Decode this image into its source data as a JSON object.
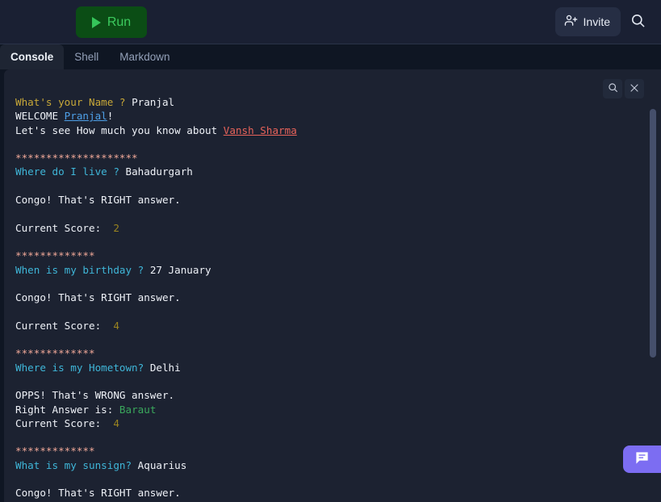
{
  "toolbar": {
    "run_label": "Run",
    "invite_label": "Invite",
    "run_icon": "play-triangle-icon",
    "invite_icon": "person-add-icon",
    "search_icon": "search-icon",
    "accent_green": "#3ccb5e",
    "run_bg": "#0b4d15"
  },
  "tabs": [
    {
      "label": "Console",
      "active": true
    },
    {
      "label": "Shell",
      "active": false
    },
    {
      "label": "Markdown",
      "active": false
    }
  ],
  "console": {
    "tools": [
      {
        "icon": "search-icon",
        "name": "console-search-button"
      },
      {
        "icon": "close-icon",
        "name": "console-close-button"
      }
    ],
    "lines": [
      {
        "id": "l1",
        "text": "What's your Name ? Pranjal"
      },
      {
        "id": "l2",
        "text": "WELCOME Pranjal!"
      },
      {
        "id": "l3",
        "text": "Let's see How much you know about Vansh Sharma"
      },
      {
        "id": "l4",
        "text": ""
      },
      {
        "id": "l5",
        "text": "********************"
      },
      {
        "id": "l6",
        "text": "Where do I live ? Bahadurgarh"
      },
      {
        "id": "l7",
        "text": ""
      },
      {
        "id": "l8",
        "text": "Congo! That's RIGHT answer."
      },
      {
        "id": "l9",
        "text": ""
      },
      {
        "id": "l10",
        "text": "Current Score:  2"
      },
      {
        "id": "l11",
        "text": ""
      },
      {
        "id": "l12",
        "text": "*************"
      },
      {
        "id": "l13",
        "text": "When is my birthday ? 27 January"
      },
      {
        "id": "l14",
        "text": ""
      },
      {
        "id": "l15",
        "text": "Congo! That's RIGHT answer."
      },
      {
        "id": "l16",
        "text": ""
      },
      {
        "id": "l17",
        "text": "Current Score:  4"
      },
      {
        "id": "l18",
        "text": ""
      },
      {
        "id": "l19",
        "text": "*************"
      },
      {
        "id": "l20",
        "text": "Where is my Hometown? Delhi"
      },
      {
        "id": "l21",
        "text": ""
      },
      {
        "id": "l22",
        "text": "OPPS! That's WRONG answer."
      },
      {
        "id": "l23",
        "text": "Right Answer is: Baraut"
      },
      {
        "id": "l24",
        "text": "Current Score:  4"
      },
      {
        "id": "l25",
        "text": ""
      },
      {
        "id": "l26",
        "text": "*************"
      },
      {
        "id": "l27",
        "text": "What is my sunsign? Aquarius"
      },
      {
        "id": "l28",
        "text": ""
      },
      {
        "id": "l29",
        "text": "Congo! That's RIGHT answer."
      }
    ],
    "segments": {
      "l1": [
        {
          "t": "What's your Name ? ",
          "c": "c-prompt"
        },
        {
          "t": "Pranjal",
          "c": "c-white"
        }
      ],
      "l2": [
        {
          "t": "WELCOME ",
          "c": "c-white"
        },
        {
          "t": "Pranjal",
          "c": "c-link"
        },
        {
          "t": "!",
          "c": "c-white"
        }
      ],
      "l3": [
        {
          "t": "Let's see How much you know about ",
          "c": "c-white"
        },
        {
          "t": "Vansh Sharma",
          "c": "c-red-link"
        }
      ],
      "l5": [
        {
          "t": "********************",
          "c": "c-stars"
        }
      ],
      "l6": [
        {
          "t": "Where do I live ? ",
          "c": "c-q"
        },
        {
          "t": "Bahadurgarh",
          "c": "c-white"
        }
      ],
      "l8": [
        {
          "t": "Congo! That's RIGHT answer.",
          "c": "c-white"
        }
      ],
      "l10": [
        {
          "t": "Current Score:  ",
          "c": "c-white"
        },
        {
          "t": "2",
          "c": "c-score"
        }
      ],
      "l12": [
        {
          "t": "*************",
          "c": "c-stars"
        }
      ],
      "l13": [
        {
          "t": "When is my birthday ? ",
          "c": "c-q"
        },
        {
          "t": "27 January",
          "c": "c-white"
        }
      ],
      "l15": [
        {
          "t": "Congo! That's RIGHT answer.",
          "c": "c-white"
        }
      ],
      "l17": [
        {
          "t": "Current Score:  ",
          "c": "c-white"
        },
        {
          "t": "4",
          "c": "c-score"
        }
      ],
      "l19": [
        {
          "t": "*************",
          "c": "c-stars"
        }
      ],
      "l20": [
        {
          "t": "Where is my Hometown? ",
          "c": "c-q"
        },
        {
          "t": "Delhi",
          "c": "c-white"
        }
      ],
      "l22": [
        {
          "t": "OPPS! That's WRONG answer.",
          "c": "c-white"
        }
      ],
      "l23": [
        {
          "t": "Right Answer is: ",
          "c": "c-white"
        },
        {
          "t": "Baraut",
          "c": "c-green"
        }
      ],
      "l24": [
        {
          "t": "Current Score:  ",
          "c": "c-white"
        },
        {
          "t": "4",
          "c": "c-score"
        }
      ],
      "l26": [
        {
          "t": "*************",
          "c": "c-stars"
        }
      ],
      "l27": [
        {
          "t": "What is my sunsign? ",
          "c": "c-q"
        },
        {
          "t": "Aquarius",
          "c": "c-white"
        }
      ],
      "l29": [
        {
          "t": "Congo! That's RIGHT answer.",
          "c": "c-white"
        }
      ]
    }
  },
  "chat": {
    "icon": "chat-bubble-icon",
    "color": "#7c6df2"
  }
}
